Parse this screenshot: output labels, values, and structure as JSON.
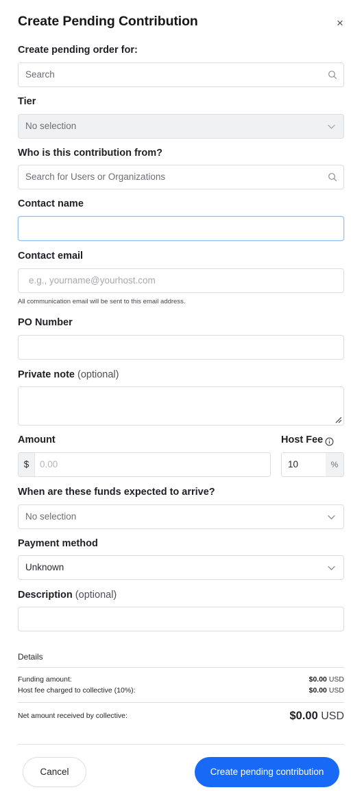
{
  "modal": {
    "title": "Create Pending Contribution",
    "close_glyph": "×"
  },
  "fields": {
    "pending_order_for": {
      "label": "Create pending order for:",
      "placeholder": "Search",
      "icon": "search-icon"
    },
    "tier": {
      "label": "Tier",
      "value": "No selection",
      "icon": "chevron-down-icon"
    },
    "contribution_from": {
      "label": "Who is this contribution from?",
      "placeholder": "Search for Users or Organizations",
      "icon": "search-icon"
    },
    "contact_name": {
      "label": "Contact name",
      "value": ""
    },
    "contact_email": {
      "label": "Contact email",
      "placeholder": "e.g., yourname@yourhost.com",
      "hint": "All communication email will be sent to this email address."
    },
    "po_number": {
      "label": "PO Number",
      "value": ""
    },
    "private_note": {
      "label": "Private note",
      "optional": "(optional)"
    },
    "amount": {
      "label": "Amount",
      "prefix": "$",
      "placeholder": "0.00"
    },
    "host_fee": {
      "label": "Host Fee",
      "value": "10",
      "suffix": "%",
      "icon": "info-icon"
    },
    "expected_arrival": {
      "label": "When are these funds expected to arrive?",
      "value": "No selection",
      "icon": "chevron-down-icon"
    },
    "payment_method": {
      "label": "Payment method",
      "value": "Unknown",
      "icon": "chevron-down-icon"
    },
    "description": {
      "label": "Description",
      "optional": "(optional)"
    }
  },
  "details": {
    "title": "Details",
    "funding_amount": {
      "label": "Funding amount:",
      "value": "$0.00",
      "currency": "USD"
    },
    "host_fee_charged": {
      "label": "Host fee charged to collective (10%):",
      "value": "$0.00",
      "currency": "USD"
    },
    "net_amount": {
      "label": "Net amount received by collective:",
      "value": "$0.00",
      "currency": "USD"
    }
  },
  "actions": {
    "cancel_label": "Cancel",
    "submit_label": "Create pending contribution"
  },
  "colors": {
    "primary": "#1869f5",
    "focus_border": "#8fc0ee",
    "border": "#dcdde0"
  }
}
